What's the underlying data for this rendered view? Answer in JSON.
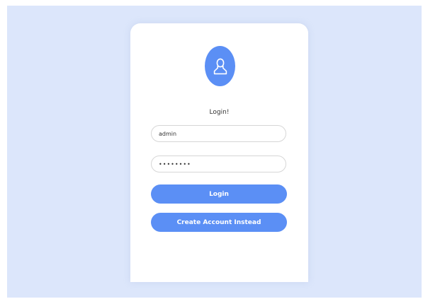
{
  "login": {
    "heading": "Login!",
    "username_value": "admin",
    "password_value": "password",
    "login_button": "Login",
    "create_account_button": "Create Account Instead"
  },
  "colors": {
    "background": "#dce6fb",
    "card": "#ffffff",
    "accent": "#5b8ff5"
  },
  "icons": {
    "avatar": "user-icon"
  }
}
